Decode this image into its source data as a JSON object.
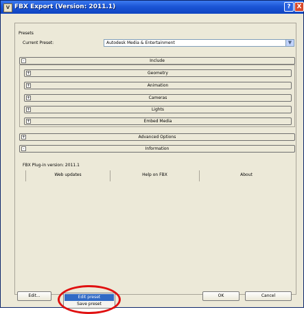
{
  "window": {
    "title": "FBX Export (Version: 2011.1)",
    "icon_label": "V",
    "help_button": "?",
    "close_button": "X"
  },
  "presets": {
    "section_label": "Presets",
    "current_preset_label": "Current Preset:",
    "current_preset_value": "Autodesk Media & Entertainment"
  },
  "include": {
    "label": "Include",
    "sign": "-",
    "items": [
      {
        "label": "Geometry",
        "sign": "+"
      },
      {
        "label": "Animation",
        "sign": "+"
      },
      {
        "label": "Cameras",
        "sign": "+"
      },
      {
        "label": "Lights",
        "sign": "+"
      },
      {
        "label": "Embed Media",
        "sign": "+"
      }
    ]
  },
  "advanced_options": {
    "label": "Advanced Options",
    "sign": "+"
  },
  "information": {
    "label": "Information",
    "sign": "-",
    "plugin_version": "FBX Plug-in version: 2011.1",
    "buttons": [
      "Web updates",
      "Help on FBX",
      "About"
    ]
  },
  "footer": {
    "edit_label": "Edit...",
    "ok_label": "OK",
    "cancel_label": "Cancel",
    "menu": [
      "Edit preset",
      "Save preset"
    ]
  },
  "colors": {
    "titlebar": "#1b55d6",
    "dialog_bg": "#ece9d8",
    "menu_selection": "#316ac5",
    "annotation_ring": "#e01010"
  }
}
